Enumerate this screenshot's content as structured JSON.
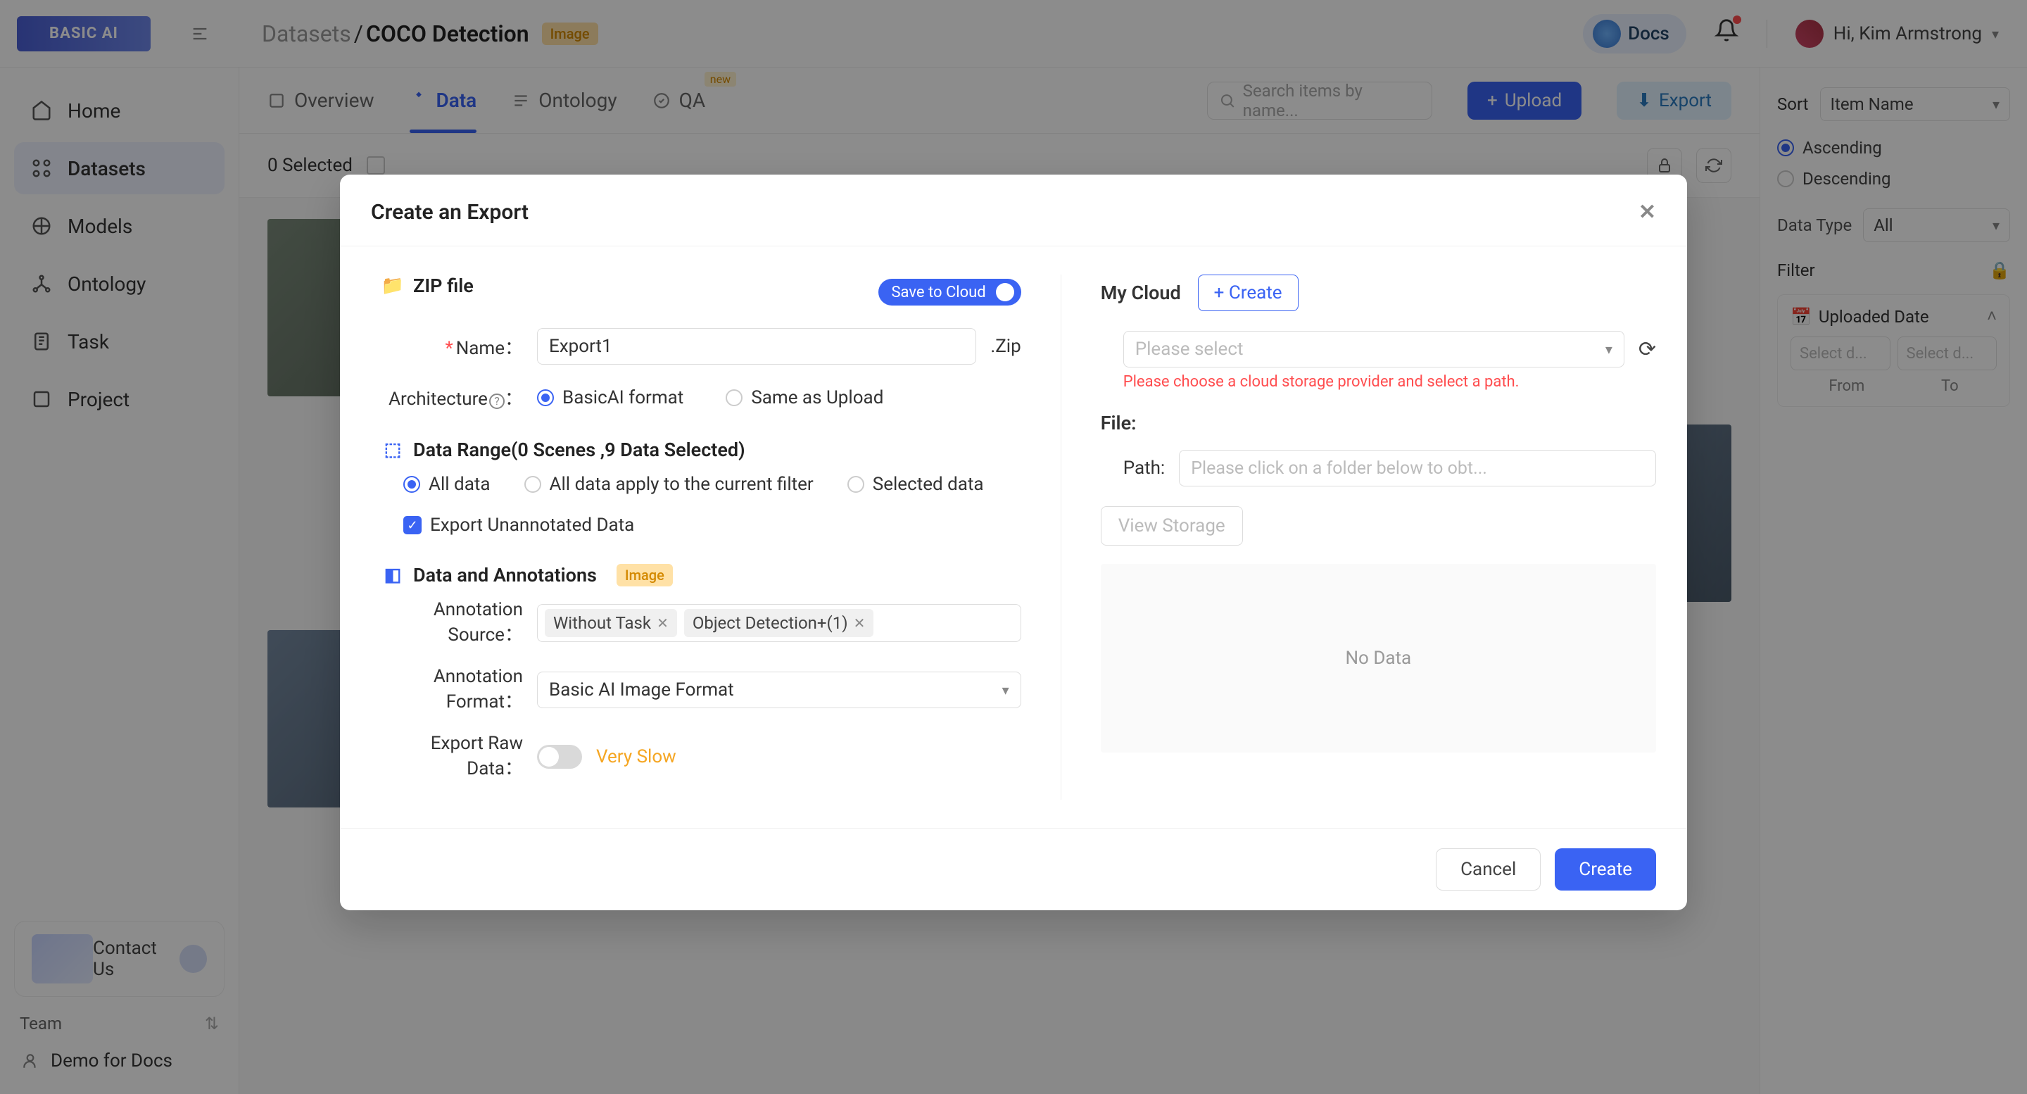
{
  "logo": "BASIC AI",
  "breadcrumb": {
    "parent": "Datasets",
    "sep": "/",
    "current": "COCO Detection",
    "tag": "Image"
  },
  "topbar": {
    "docs": "Docs",
    "greeting": "Hi, Kim Armstrong"
  },
  "sidebar": {
    "items": [
      "Home",
      "Datasets",
      "Models",
      "Ontology",
      "Task",
      "Project"
    ],
    "contact": "Contact Us",
    "team_label": "Team",
    "team_name": "Demo for Docs"
  },
  "tabs": {
    "overview": "Overview",
    "data": "Data",
    "ontology": "Ontology",
    "qa": "QA",
    "new_badge": "new"
  },
  "toolbar": {
    "search_placeholder": "Search items by name...",
    "upload": "Upload",
    "export": "Export"
  },
  "content": {
    "selected": "0 Selected"
  },
  "right": {
    "sort_label": "Sort",
    "sort_value": "Item Name",
    "asc": "Ascending",
    "desc": "Descending",
    "datatype_label": "Data Type",
    "datatype_value": "All",
    "filter": "Filter",
    "uploaded": "Uploaded Date",
    "date_placeholder": "Select d...",
    "from": "From",
    "to": "To"
  },
  "modal": {
    "title": "Create an Export",
    "zip_section": "ZIP file",
    "save_to_cloud": "Save to Cloud",
    "name_label": "Name",
    "name_value": "Export1",
    "zip_suffix": ".Zip",
    "arch_label": "Architecture",
    "arch_basicai": "BasicAI format",
    "arch_same": "Same as Upload",
    "range_section": "Data Range(0 Scenes ,9 Data Selected)",
    "range_all": "All data",
    "range_filter": "All data apply to the current filter",
    "range_selected": "Selected data",
    "export_unannotated": "Export Unannotated Data",
    "ann_section": "Data and Annotations",
    "ann_tag": "Image",
    "ann_source_label": "Annotation Source",
    "ann_source_1": "Without Task",
    "ann_source_2": "Object Detection+(1)",
    "ann_format_label": "Annotation Format",
    "ann_format_value": "Basic AI Image Format",
    "raw_label": "Export Raw Data",
    "very_slow": "Very Slow",
    "mycloud": "My Cloud",
    "create": "+ Create",
    "cloud_placeholder": "Please select",
    "cloud_warn": "Please choose a cloud storage provider and select a path.",
    "file": "File:",
    "path_label": "Path:",
    "path_placeholder": "Please click on a folder below to obt...",
    "view_storage": "View Storage",
    "no_data": "No Data",
    "cancel": "Cancel",
    "create_btn": "Create"
  }
}
